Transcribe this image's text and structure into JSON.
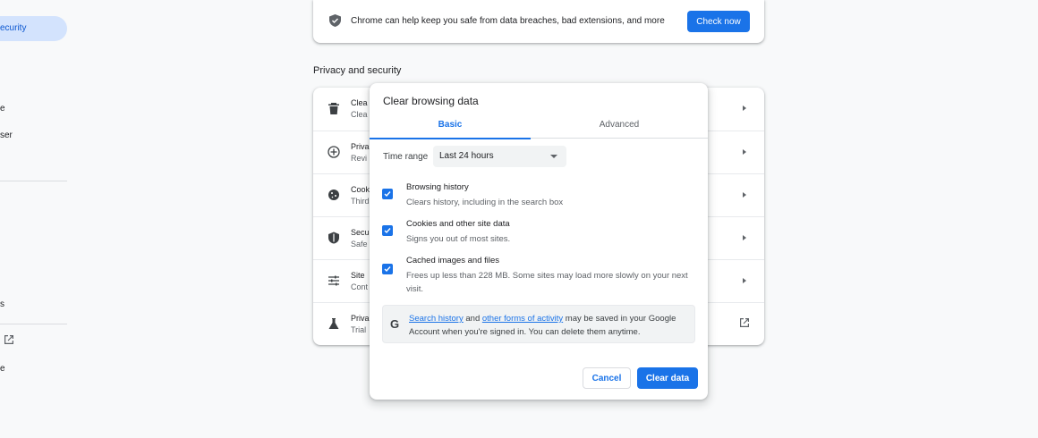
{
  "sidebar": {
    "active_label": "ecurity",
    "items": [
      "e",
      "ser",
      "s",
      "e"
    ]
  },
  "safety_check": {
    "message": "Chrome can help keep you safe from data breaches, bad extensions, and more",
    "button": "Check now"
  },
  "privacy": {
    "title": "Privacy and security",
    "rows": [
      {
        "t1": "Clea",
        "t2": "Clea",
        "icon": "trash-icon"
      },
      {
        "t1": "Priva",
        "t2": "Revi",
        "icon": "privacy-guide-icon"
      },
      {
        "t1": "Cook",
        "t2": "Third",
        "icon": "cookie-icon"
      },
      {
        "t1": "Secu",
        "t2": "Safe",
        "icon": "shield-icon"
      },
      {
        "t1": "Site",
        "t2": "Cont",
        "icon": "tune-icon"
      },
      {
        "t1": "Priva",
        "t2": "Trial",
        "icon": "flask-icon"
      }
    ]
  },
  "dialog": {
    "title": "Clear browsing data",
    "tabs": {
      "basic": "Basic",
      "advanced": "Advanced"
    },
    "time_range_label": "Time range",
    "time_range_value": "Last 24 hours",
    "options": [
      {
        "title": "Browsing history",
        "desc": "Clears history, including in the search box",
        "checked": true
      },
      {
        "title": "Cookies and other site data",
        "desc": "Signs you out of most sites.",
        "checked": true
      },
      {
        "title": "Cached images and files",
        "desc": "Frees up less than 228 MB. Some sites may load more slowly on your next visit.",
        "checked": true
      }
    ],
    "google_note": {
      "link1": "Search history",
      "and": " and ",
      "link2": "other forms of activity",
      "rest": " may be saved in your Google Account when you're signed in. You can delete them anytime."
    },
    "cancel": "Cancel",
    "clear": "Clear data"
  },
  "colors": {
    "accent": "#1a73e8",
    "active_nav_bg": "#d3e3fd"
  }
}
